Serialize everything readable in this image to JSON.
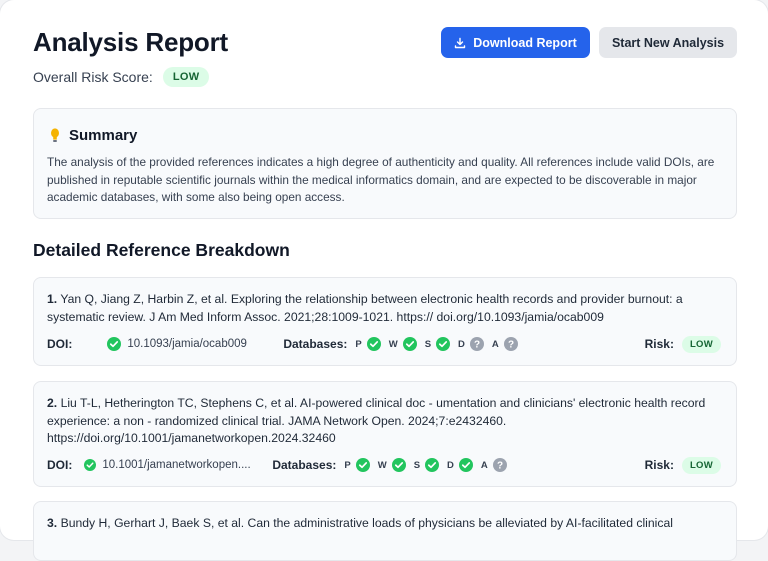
{
  "header": {
    "title": "Analysis Report",
    "download_label": "Download Report",
    "new_analysis_label": "Start New Analysis"
  },
  "overall_risk": {
    "label": "Overall Risk Score:",
    "value": "LOW"
  },
  "summary": {
    "title": "Summary",
    "text": "The analysis of the provided references indicates a high degree of authenticity and quality. All references include valid DOIs, are published in reputable scientific journals within the medical informatics domain, and are expected to be discoverable in major academic databases, with some also being open access."
  },
  "breakdown_title": "Detailed Reference Breakdown",
  "labels": {
    "doi": "DOI:",
    "databases": "Databases:",
    "risk": "Risk:"
  },
  "colors": {
    "check": "#22c55e",
    "unknown": "#9ca3af",
    "primary": "#2563eb"
  },
  "references": [
    {
      "num": "1.",
      "text": "Yan Q, Jiang Z, Harbin Z, et al. Exploring the relationship between electronic health records and provider burnout: a systematic review. J Am Med Inform Assoc. 2021;28:1009-1021. https:// doi.org/10.1093/jamia/ocab009",
      "doi": "10.1093/jamia/ocab009",
      "risk": "LOW",
      "databases": [
        {
          "letter": "P",
          "status": "check"
        },
        {
          "letter": "W",
          "status": "check"
        },
        {
          "letter": "S",
          "status": "check"
        },
        {
          "letter": "D",
          "status": "unknown"
        },
        {
          "letter": "A",
          "status": "unknown"
        }
      ]
    },
    {
      "num": "2.",
      "text": "Liu T-L, Hetherington TC, Stephens C, et al. AI-powered clinical doc - umentation and clinicians' electronic health record experience: a non - randomized clinical trial. JAMA Network Open. 2024;7:e2432460. https://doi.org/10.1001/jamanetworkopen.2024.32460",
      "doi": "10.1001/jamanetworkopen....",
      "risk": "LOW",
      "databases": [
        {
          "letter": "P",
          "status": "check"
        },
        {
          "letter": "W",
          "status": "check"
        },
        {
          "letter": "S",
          "status": "check"
        },
        {
          "letter": "D",
          "status": "check"
        },
        {
          "letter": "A",
          "status": "unknown"
        }
      ]
    },
    {
      "num": "3.",
      "text": "Bundy H, Gerhart J, Baek S, et al. Can the administrative loads of physicians be alleviated by AI-facilitated clinical"
    }
  ]
}
